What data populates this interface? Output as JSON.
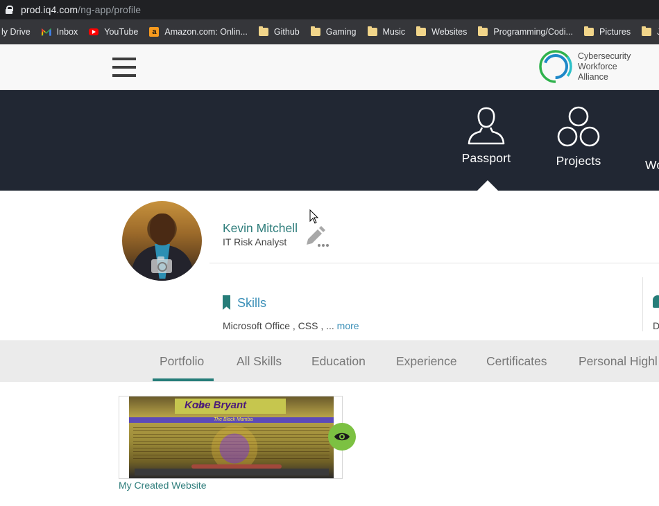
{
  "browser": {
    "url_host": "prod.iq4.com",
    "url_path": "/ng-app/profile",
    "bookmarks": [
      {
        "label": "ly Drive",
        "icon": "drive-icon"
      },
      {
        "label": "Inbox",
        "icon": "gmail-icon"
      },
      {
        "label": "YouTube",
        "icon": "youtube-icon"
      },
      {
        "label": "Amazon.com: Onlin...",
        "icon": "amazon-icon"
      },
      {
        "label": "Github",
        "icon": "folder-icon"
      },
      {
        "label": "Gaming",
        "icon": "folder-icon"
      },
      {
        "label": "Music",
        "icon": "folder-icon"
      },
      {
        "label": "Websites",
        "icon": "folder-icon"
      },
      {
        "label": "Programming/Codi...",
        "icon": "folder-icon"
      },
      {
        "label": "Pictures",
        "icon": "folder-icon"
      },
      {
        "label": "Jo",
        "icon": "folder-icon"
      }
    ]
  },
  "header": {
    "logo_lines": [
      "Cybersecurity",
      "Workforce",
      "Alliance"
    ],
    "logo_colors": [
      "#2fb24c",
      "#1e88c8",
      "#2bc0c8"
    ]
  },
  "nav": {
    "items": [
      {
        "label": "Passport",
        "icon": "person-icon",
        "active": true
      },
      {
        "label": "Projects",
        "icon": "projects-icon"
      },
      {
        "label": "Wo",
        "icon": ""
      }
    ]
  },
  "profile": {
    "name": "Kevin Mitchell",
    "title": "IT Risk Analyst",
    "skills": {
      "heading": "Skills",
      "list": "Microsoft Office , CSS , ... ",
      "more": "more"
    },
    "right_partial": "D"
  },
  "tabs": [
    {
      "label": "Portfolio",
      "active": true
    },
    {
      "label": "All Skills"
    },
    {
      "label": "Education"
    },
    {
      "label": "Experience"
    },
    {
      "label": "Certificates"
    },
    {
      "label": "Personal Highl"
    }
  ],
  "portfolio": {
    "items": [
      {
        "caption": "My Created Website",
        "thumb_title": "Kobe Bryant",
        "thumb_number": "24",
        "thumb_subtitle": "The Black Mamba"
      }
    ]
  },
  "colors": {
    "teal": "#267d79",
    "link_blue": "#3a8fb7",
    "nav_dark": "#212733",
    "eye_green": "#7cc142"
  }
}
